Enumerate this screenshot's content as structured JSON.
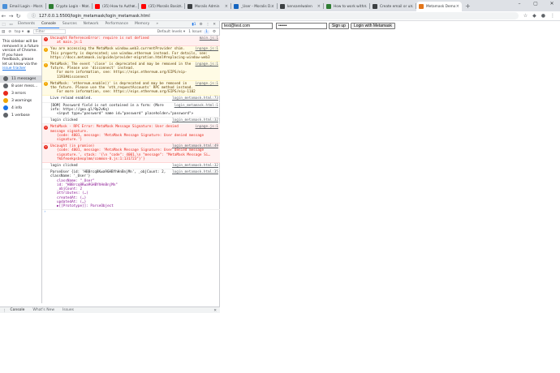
{
  "browser": {
    "tabs": [
      {
        "label": "Email Login - Mor...",
        "color": "#4a90d9"
      },
      {
        "label": "Crypto Login - Mo...",
        "color": "#2e7d32"
      },
      {
        "label": "(35) How to Authe...",
        "color": "#ff0000"
      },
      {
        "label": "(35) Moralis Basic...",
        "color": "#ff0000"
      },
      {
        "label": "Moralis Admin",
        "color": "#3c4043"
      },
      {
        "label": "_User - Moralis D...",
        "color": "#1565c0"
      },
      {
        "label": "kensarelwalen",
        "color": "#3c4043"
      },
      {
        "label": "How to work with...",
        "color": "#2e7d32"
      },
      {
        "label": "Create email or u...",
        "color": "#3c4043"
      },
      {
        "label": "Metamask Demo",
        "color": "#e2761b"
      }
    ],
    "new_tab": "+",
    "url": "127.0.0.1:5500/login_metamask/login_metamask.html"
  },
  "devtools": {
    "tabs": [
      "Elements",
      "Console",
      "Sources",
      "Network",
      "Performance",
      "Memory",
      "»"
    ],
    "active_tab": "Console",
    "issue_count": "1",
    "filter": {
      "context": "top",
      "placeholder": "Filter",
      "levels": "Default levels ▾",
      "issues": "1 Issue: ",
      "issues_count": "1"
    },
    "sidebar": {
      "note": "This sidebar will be removed in a future version of Chrome. If you have feedback, please let us know via the",
      "note_link": "issue tracker",
      "items": [
        {
          "label": "11 messages",
          "color": "#5f6368"
        },
        {
          "label": "8 user mess...",
          "color": "#5f6368"
        },
        {
          "label": "3 errors",
          "color": "#e8291c"
        },
        {
          "label": "3 warnings",
          "color": "#f2a600"
        },
        {
          "label": "4 info",
          "color": "#1a73e8"
        },
        {
          "label": "1 verbose",
          "color": "#5f6368"
        }
      ]
    },
    "messages": [
      {
        "level": "err",
        "text": "Uncaught ReferenceError: require is not defined",
        "text2": "at main.js:1",
        "source": "main.js:1"
      },
      {
        "level": "warn",
        "text": "You are accessing the MetaMask window.web3.currentProvider shim. This property is deprecated; use window.ethereum instead. For details, see: https://docs.metamask.io/guide/provider-migration.html#replacing-window-web3",
        "source": "inpage.js:1"
      },
      {
        "level": "warn",
        "text": "MetaMask: The event 'close' is deprecated and may be removed in the future. Please use 'disconnect' instead.",
        "text2": "For more information, see: https://eips.ethereum.org/EIPS/eip-1193#disconnect",
        "source": "inpage.js:1"
      },
      {
        "level": "warn",
        "text": "MetaMask: 'ethereum.enable()' is deprecated and may be removed in the future. Please use the 'eth_requestAccounts' RPC method instead.",
        "text2": "For more information, see: https://eips.ethereum.org/EIPS/eip-1102",
        "source": "inpage.js:1"
      },
      {
        "level": "info",
        "text": "Live reload enabled.",
        "source": "login_metamask.html:73"
      },
      {
        "level": "info",
        "text": "[DOM] Password field is not contained in a form: (More info: https://goo.gl/9p2vKq)",
        "text2": "<input type=\"password\" name id=\"password\" placeholder=\"password\">",
        "source": "login_metamask.html:1"
      },
      {
        "level": "info",
        "text": "login clicked",
        "source": "login_metamask.html:32"
      },
      {
        "level": "err",
        "text": "MetaMask - RPC Error: MetaMask Message Signature: User denied message signature.",
        "text2": "{code: 4001, message: 'MetaMask Message Signature: User denied message signature.'}",
        "source": "inpage.js:1"
      },
      {
        "level": "err",
        "text": "Uncaught (in promise)",
        "text2": "{code: 4001, message: 'MetaMask Message Signature: User denied message signature.', stack: '{\\n \"code\": 4001,\\n \"message\": \"MetaMask Message Si…fkbfeoekpsbeoplmm/common-0.js:1:131723\"}'}",
        "source": "login_metamask.html:49"
      },
      {
        "level": "info",
        "text": "login clicked",
        "source": "login_metamask.html:32"
      }
    ],
    "object": {
      "source": "login_metamask.html:35",
      "header": "ParseUser {id: 'HBBrcq8Kwa9GHBYhHnBnjMn', _objCount: 2, className: '_User'}",
      "lines": [
        "className: \"_User\"",
        "id: \"HBBrcq8Kwa9GHBYhHnBnjMn\"",
        "_objCount: 2",
        "attributes: (…)",
        "createdAt: (…)",
        "updatedAt: (…)",
        "▶[[Prototype]]: ParseObject"
      ]
    },
    "prompt": "›",
    "drawer_tabs": [
      "Console",
      "What's New",
      "Issues"
    ],
    "drawer_active": "Console"
  },
  "page": {
    "email_value": "test@test.com",
    "password_value": "••••••",
    "signup_label": "Sign up",
    "login_label": "Login with Metamask"
  }
}
